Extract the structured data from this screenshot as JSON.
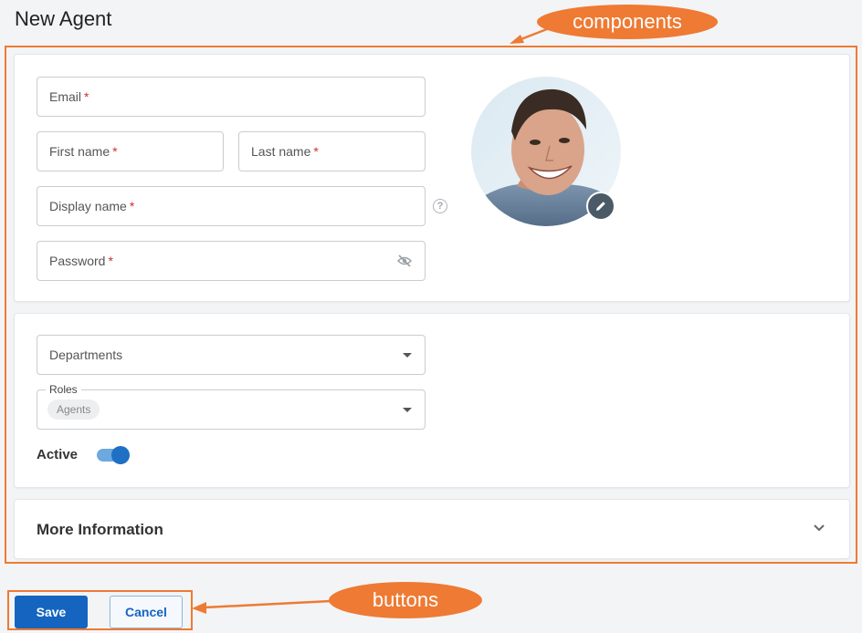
{
  "page": {
    "title": "New Agent"
  },
  "profile": {
    "email_label": "Email",
    "first_name_label": "First name",
    "last_name_label": "Last name",
    "display_name_label": "Display name",
    "password_label": "Password",
    "required_mark": "*",
    "help_icon": "question-circle-icon",
    "password_toggle_icon": "eye-off-icon",
    "avatar_edit_icon": "pencil-icon"
  },
  "assignment": {
    "departments_label": "Departments",
    "roles_label": "Roles",
    "roles_selected": [
      "Agents"
    ],
    "active_label": "Active",
    "active_value": true
  },
  "more": {
    "title": "More Information",
    "expand_icon": "chevron-down-icon"
  },
  "buttons": {
    "save_label": "Save",
    "cancel_label": "Cancel"
  },
  "annotations": {
    "components_label": "components",
    "buttons_label": "buttons"
  },
  "colors": {
    "accent": "#1565c0",
    "annotation": "#ee7a33",
    "required": "#d32f2f"
  }
}
